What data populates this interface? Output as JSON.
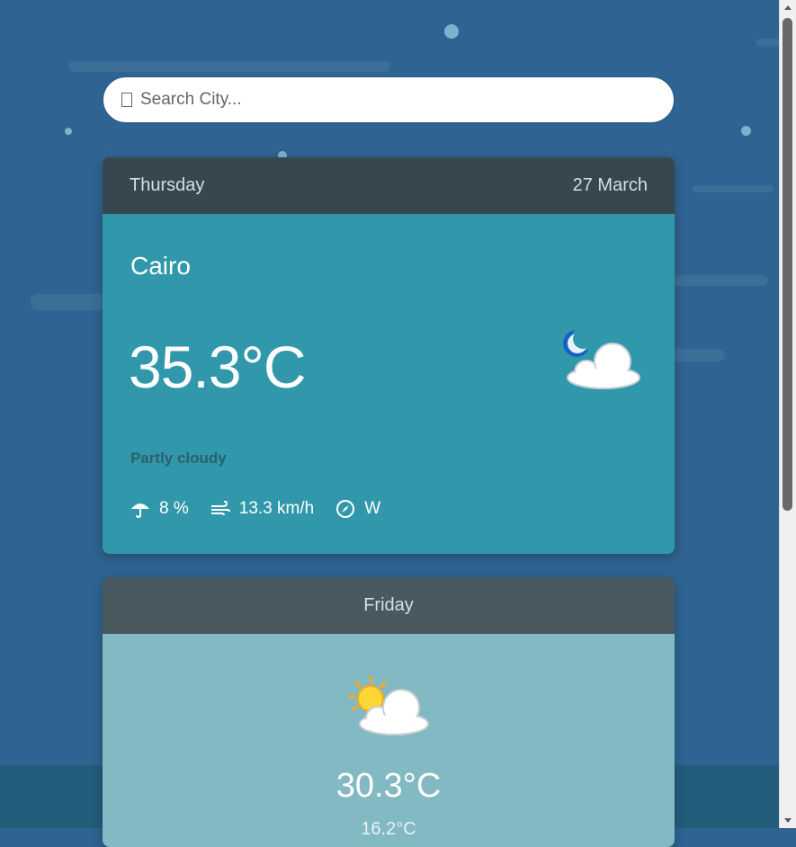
{
  "search": {
    "placeholder": "Search City..."
  },
  "today": {
    "day": "Thursday",
    "date": "27 March",
    "city": "Cairo",
    "temperature": "35.3°C",
    "condition": "Partly cloudy",
    "icon": "partly-cloudy-night-icon",
    "rain_chance": "8 %",
    "wind_speed": "13.3 km/h",
    "wind_direction": "W"
  },
  "tomorrow": {
    "day": "Friday",
    "icon": "partly-cloudy-day-icon",
    "max_temp": "30.3°C",
    "min_temp": "16.2°C"
  },
  "colors": {
    "background": "#2f6391",
    "card_header": "#37474f",
    "today_body": "#3198ab",
    "tomorrow_body": "#82b9c2"
  }
}
